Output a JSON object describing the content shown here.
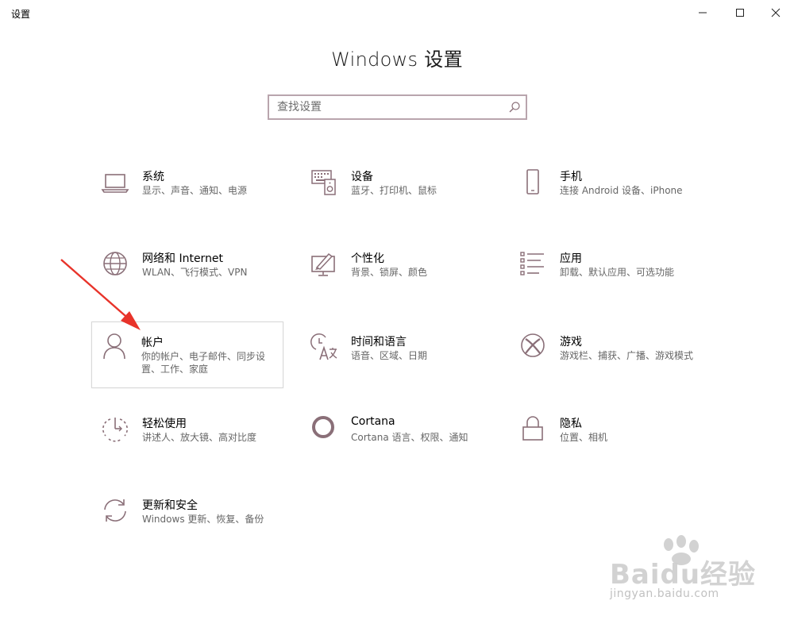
{
  "window": {
    "title": "设置",
    "controls": [
      "minimize",
      "maximize",
      "close"
    ]
  },
  "header": {
    "title": "Windows 设置"
  },
  "search": {
    "placeholder": "查找设置",
    "icon": "search-icon"
  },
  "categories": [
    {
      "id": "system",
      "name": "系统",
      "desc": "显示、声音、通知、电源",
      "icon": "laptop-icon"
    },
    {
      "id": "devices",
      "name": "设备",
      "desc": "蓝牙、打印机、鼠标",
      "icon": "keyboard-speaker-icon"
    },
    {
      "id": "phone",
      "name": "手机",
      "desc": "连接 Android 设备、iPhone",
      "icon": "phone-icon"
    },
    {
      "id": "network",
      "name": "网络和 Internet",
      "desc": "WLAN、飞行模式、VPN",
      "icon": "globe-icon"
    },
    {
      "id": "personalization",
      "name": "个性化",
      "desc": "背景、锁屏、颜色",
      "icon": "paint-monitor-icon"
    },
    {
      "id": "apps",
      "name": "应用",
      "desc": "卸载、默认应用、可选功能",
      "icon": "app-list-icon"
    },
    {
      "id": "accounts",
      "name": "帐户",
      "desc": "你的帐户、电子邮件、同步设置、工作、家庭",
      "icon": "person-icon",
      "selected": true
    },
    {
      "id": "time-language",
      "name": "时间和语言",
      "desc": "语音、区域、日期",
      "icon": "clock-language-icon"
    },
    {
      "id": "gaming",
      "name": "游戏",
      "desc": "游戏栏、捕获、广播、游戏模式",
      "icon": "xbox-icon"
    },
    {
      "id": "ease-of-access",
      "name": "轻松使用",
      "desc": "讲述人、放大镜、高对比度",
      "icon": "ease-of-access-icon"
    },
    {
      "id": "cortana",
      "name": "Cortana",
      "desc": "Cortana 语言、权限、通知",
      "icon": "cortana-ring-icon"
    },
    {
      "id": "privacy",
      "name": "隐私",
      "desc": "位置、相机",
      "icon": "lock-icon"
    },
    {
      "id": "update-security",
      "name": "更新和安全",
      "desc": "Windows 更新、恢复、备份",
      "icon": "sync-arrows-icon"
    }
  ],
  "annotation": {
    "color": "#e8332a",
    "target": "accounts"
  },
  "watermark": {
    "brand": "Baidu经验",
    "url": "jingyan.baidu.com"
  },
  "colors": {
    "accent_icon": "#8a6f78",
    "search_border": "#b9a5ad",
    "tile_text": "#000000",
    "tile_desc": "#666666"
  }
}
